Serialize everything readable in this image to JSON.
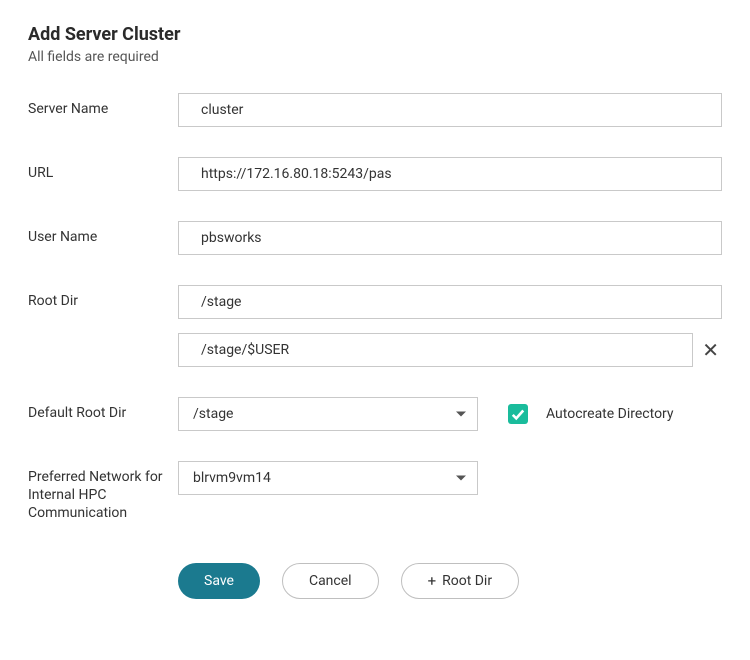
{
  "title": "Add Server Cluster",
  "subtitle": "All fields are required",
  "labels": {
    "server_name": "Server Name",
    "url": "URL",
    "user_name": "User Name",
    "root_dir": "Root Dir",
    "default_root_dir": "Default Root Dir",
    "autocreate": "Autocreate Directory",
    "preferred_network": "Preferred Network for Internal HPC Communication"
  },
  "values": {
    "server_name": "cluster",
    "url": "https://172.16.80.18:5243/pas",
    "user_name": "pbsworks",
    "root_dir": "/stage",
    "root_dir_extra": "/stage/$USER",
    "default_root_dir": "/stage",
    "preferred_network": "blrvm9vm14"
  },
  "buttons": {
    "save": "Save",
    "cancel": "Cancel",
    "add_root_dir": "Root Dir",
    "plus": "+"
  },
  "colors": {
    "primary_button": "#1b7a8f",
    "checkbox": "#1abc9c"
  }
}
